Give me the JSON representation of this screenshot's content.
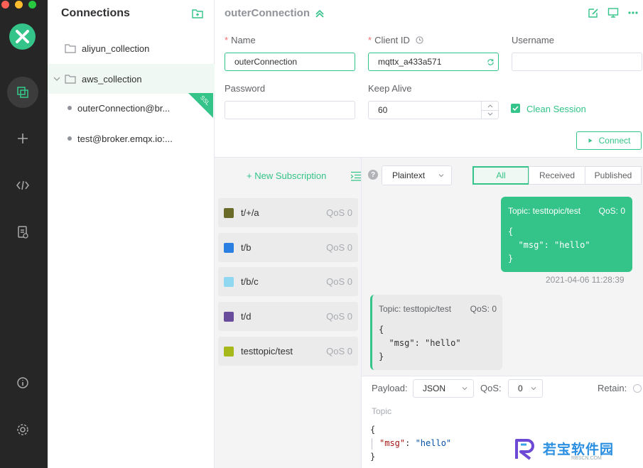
{
  "colors": {
    "accent": "#34c388",
    "rail": "#262626",
    "danger": "#f56c6c"
  },
  "sidebar": {
    "title": "Connections",
    "collections": [
      {
        "label": "aliyun_collection"
      },
      {
        "label": "aws_collection"
      }
    ],
    "connections": [
      {
        "label": "outerConnection@br..."
      },
      {
        "label": "test@broker.emqx.io:..."
      }
    ],
    "ssl_badge": "SSL"
  },
  "form": {
    "title": "outerConnection",
    "name_label": "Name",
    "name_value": "outerConnection",
    "client_id_label": "Client ID",
    "client_id_value": "mqttx_a433a571",
    "username_label": "Username",
    "username_value": "",
    "password_label": "Password",
    "password_value": "",
    "keep_alive_label": "Keep Alive",
    "keep_alive_value": "60",
    "clean_session_label": "Clean Session",
    "clean_session_checked": true,
    "connect_label": "Connect"
  },
  "subscriptions": {
    "new_label": "+ New Subscription",
    "items": [
      {
        "topic": "t/+/a",
        "qos": "QoS 0",
        "color": "#6b6b29"
      },
      {
        "topic": "t/b",
        "qos": "QoS 0",
        "color": "#2b7fe0"
      },
      {
        "topic": "t/b/c",
        "qos": "QoS 0",
        "color": "#90d8f2"
      },
      {
        "topic": "t/d",
        "qos": "QoS 0",
        "color": "#6a4c9c"
      },
      {
        "topic": "testtopic/test",
        "qos": "QoS 0",
        "color": "#a6b81a"
      }
    ]
  },
  "messages": {
    "payload_type": "Plaintext",
    "filters": [
      "All",
      "Received",
      "Published"
    ],
    "active_filter": "All",
    "outgoing": {
      "topic": "Topic: testtopic/test",
      "qos": "QoS: 0",
      "body": "{\n  \"msg\": \"hello\"\n}",
      "time": "2021-04-06 11:28:39"
    },
    "incoming": {
      "topic": "Topic: testtopic/test",
      "qos": "QoS: 0",
      "body": "{\n  \"msg\": \"hello\"\n}"
    }
  },
  "composer": {
    "payload_label": "Payload:",
    "payload_format": "JSON",
    "qos_label": "QoS:",
    "qos_value": "0",
    "retain_label": "Retain:",
    "topic_placeholder": "Topic",
    "code_open": "{",
    "code_key": "\"msg\"",
    "code_colon": ": ",
    "code_value": "\"hello\"",
    "code_close": "}"
  },
  "watermark": {
    "text": "若宝软件园",
    "sub": "RBSCN.COM"
  }
}
